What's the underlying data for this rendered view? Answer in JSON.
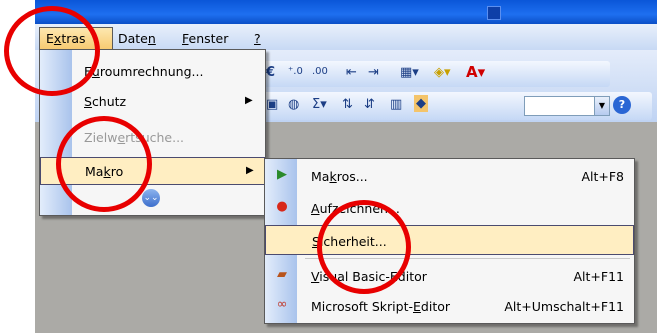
{
  "menubar": {
    "items": [
      {
        "pre": "E",
        "u": "x",
        "post": "tras"
      },
      {
        "pre": "Date",
        "u": "n",
        "post": ""
      },
      {
        "pre": "",
        "u": "F",
        "post": "enster"
      },
      {
        "pre": "",
        "u": "?",
        "post": ""
      }
    ]
  },
  "extras_menu": {
    "items": [
      {
        "pre": "E",
        "u": "u",
        "post": "roumrechnung...",
        "disabled": false
      },
      {
        "pre": "",
        "u": "S",
        "post": "chutz",
        "disabled": false
      },
      {
        "pre": "Zielw",
        "u": "e",
        "post": "rtsuche...",
        "disabled": true
      },
      {
        "pre": "Ma",
        "u": "k",
        "post": "ro",
        "disabled": false
      }
    ],
    "expand_icon": "chevron-double-down-icon"
  },
  "macro_submenu": {
    "items": [
      {
        "pre": "Ma",
        "u": "k",
        "post": "ros...",
        "shortcut": "Alt+F8",
        "icon": "play-icon"
      },
      {
        "pre": "",
        "u": "A",
        "post": "ufzeichnen...",
        "shortcut": "",
        "icon": "record-icon"
      },
      {
        "pre": "",
        "u": "S",
        "post": "icherheit...",
        "shortcut": "",
        "icon": ""
      },
      {
        "pre": "",
        "u": "V",
        "post": "isual Basic-Editor",
        "shortcut": "Alt+F11",
        "icon": "vba-editor-icon"
      },
      {
        "pre": "Microsoft Skript-",
        "u": "E",
        "post": "ditor",
        "shortcut": "Alt+Umschalt+F11",
        "icon": "script-editor-icon"
      }
    ]
  },
  "toolbar": {
    "row1_icons": [
      "euro-icon",
      "increase-decimal-icon",
      "decrease-decimal-icon",
      "decrease-indent-icon",
      "increase-indent-icon",
      "borders-icon",
      "fill-color-icon",
      "font-color-icon"
    ],
    "row2_icons": [
      "paste-icon",
      "hyperlink-icon",
      "autosum-icon",
      "sort-ascending-icon",
      "sort-descending-icon",
      "chart-icon",
      "drawing-icon",
      "zoom-combo",
      "help-icon"
    ],
    "sigma": "Σ"
  },
  "colors": {
    "annotation_red": "#e80000",
    "highlight": "#ffeec2",
    "titlebar_blue": "#0a56d8"
  }
}
